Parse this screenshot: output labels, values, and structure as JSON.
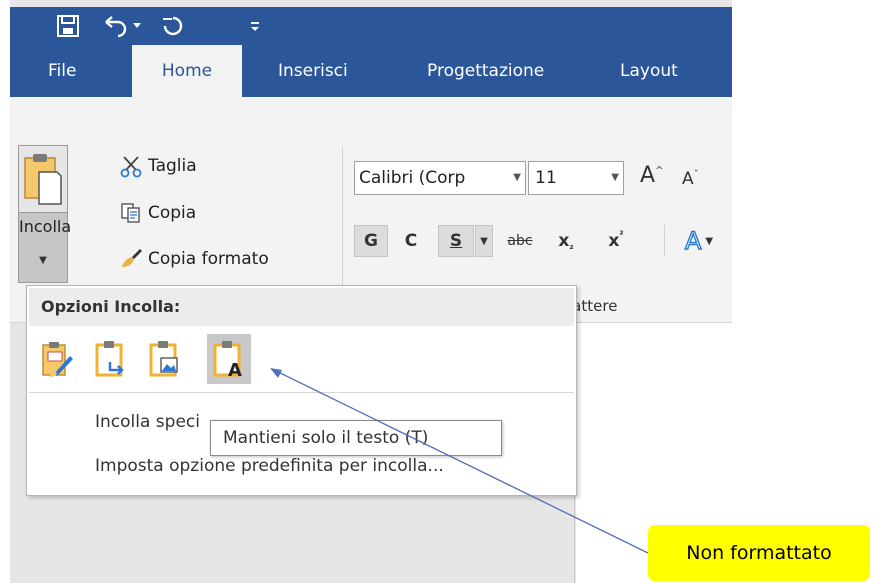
{
  "tabs": [
    "File",
    "Home",
    "Inserisci",
    "Progettazione",
    "Layout"
  ],
  "clipboard": {
    "paste_label": "Incolla",
    "cut_label": "Taglia",
    "copy_label": "Copia",
    "format_painter_label": "Copia formato"
  },
  "font": {
    "name": "Calibri (Corp",
    "size": "11",
    "bold": "G",
    "italic": "C",
    "underline": "S",
    "strikethrough": "abc",
    "subscript": "x",
    "superscript": "x",
    "group_label": "rattere"
  },
  "paste_menu": {
    "header": "Opzioni Incolla:",
    "options": [
      "keep-source-formatting-icon",
      "merge-formatting-icon",
      "picture-icon",
      "keep-text-only-icon"
    ],
    "special_item_visible": "Incolla spec",
    "special_item_tail": "i",
    "default_item": "Imposta opzione predefinita per incolla..."
  },
  "tooltip": "Mantieni solo il testo (T)",
  "callout": "Non formattato",
  "colors": {
    "word_blue": "#2b579a",
    "callout_yellow": "#ffff00",
    "arrow": "#4f6fb8"
  }
}
